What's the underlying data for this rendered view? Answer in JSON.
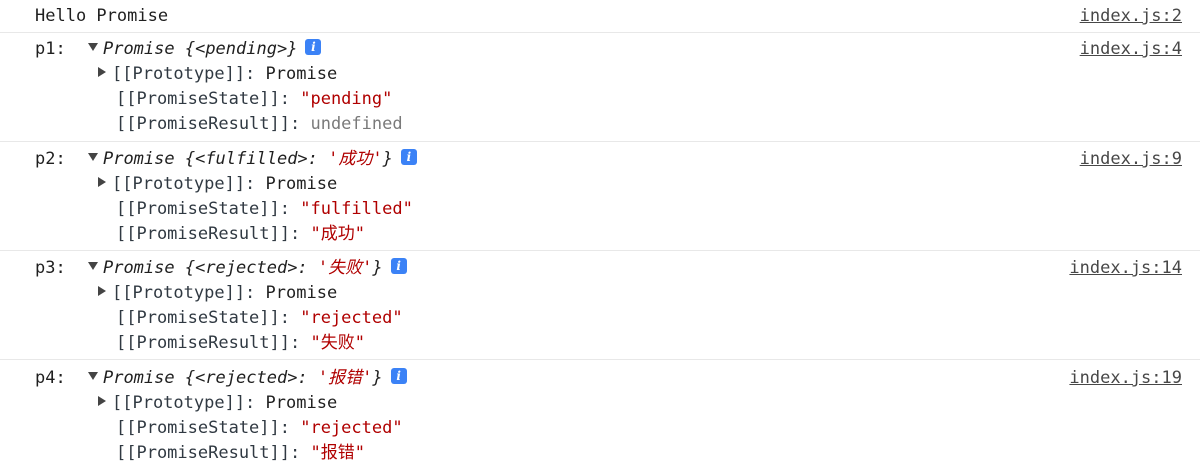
{
  "log": {
    "text": "Hello Promise",
    "source": "index.js:2"
  },
  "promises": [
    {
      "name": "p1:",
      "summary_prefix": "Promise {<pending>}",
      "summary_value": "",
      "summary_suffix": "",
      "source": "index.js:4",
      "prototype_key": "[[Prototype]]: ",
      "prototype_value": "Promise",
      "state_key": "[[PromiseState]]: ",
      "state_value": "\"pending\"",
      "result_key": "[[PromiseResult]]: ",
      "result_value": "undefined"
    },
    {
      "name": "p2:",
      "summary_prefix": "Promise {<fulfilled>: ",
      "summary_value": "'成功'",
      "summary_suffix": "}",
      "source": "index.js:9",
      "prototype_key": "[[Prototype]]: ",
      "prototype_value": "Promise",
      "state_key": "[[PromiseState]]: ",
      "state_value": "\"fulfilled\"",
      "result_key": "[[PromiseResult]]: ",
      "result_value": "\"成功\""
    },
    {
      "name": "p3:",
      "summary_prefix": "Promise {<rejected>: ",
      "summary_value": "'失败'",
      "summary_suffix": "}",
      "source": "index.js:14",
      "prototype_key": "[[Prototype]]: ",
      "prototype_value": "Promise",
      "state_key": "[[PromiseState]]: ",
      "state_value": "\"rejected\"",
      "result_key": "[[PromiseResult]]: ",
      "result_value": "\"失败\""
    },
    {
      "name": "p4:",
      "summary_prefix": "Promise {<rejected>: ",
      "summary_value": "'报错'",
      "summary_suffix": "}",
      "source": "index.js:19",
      "prototype_key": "[[Prototype]]: ",
      "prototype_value": "Promise",
      "state_key": "[[PromiseState]]: ",
      "state_value": "\"rejected\"",
      "result_key": "[[PromiseResult]]: ",
      "result_value": "\"报错\""
    }
  ],
  "info_glyph": "i",
  "colors": {
    "string": "#b00000",
    "undefined": "#7a7a7a",
    "info_icon": "#3b82f6",
    "divider": "#e8e8e8"
  }
}
